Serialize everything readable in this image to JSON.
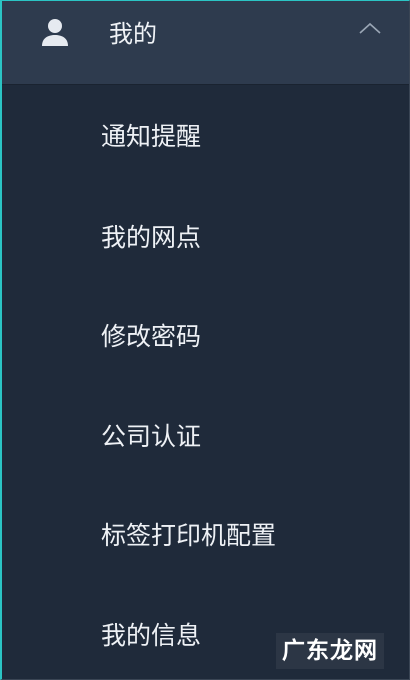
{
  "header": {
    "label": "我的",
    "user_icon": "user-icon",
    "chevron_icon": "chevron-up-icon",
    "expanded": true
  },
  "menu": {
    "items": [
      {
        "label": "通知提醒"
      },
      {
        "label": "我的网点"
      },
      {
        "label": "修改密码"
      },
      {
        "label": "公司认证"
      },
      {
        "label": "标签打印机配置"
      },
      {
        "label": "我的信息"
      }
    ]
  },
  "watermark": {
    "text": "广东龙网"
  },
  "colors": {
    "panel_background": "#1f2a3a",
    "header_background": "#2e3b4e",
    "text": "#eef1f5",
    "accent_border": "#2bc4c4"
  }
}
